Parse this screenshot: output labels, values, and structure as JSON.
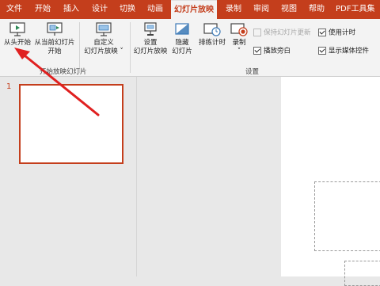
{
  "tabs": [
    "文件",
    "开始",
    "插入",
    "设计",
    "切换",
    "动画",
    "幻灯片放映",
    "录制",
    "审阅",
    "视图",
    "帮助",
    "PDF工具集"
  ],
  "active_tab": "幻灯片放映",
  "ribbon": {
    "from_beginning": "从头开始",
    "from_current_1": "从当前幻灯片",
    "from_current_2": "开始",
    "custom_1": "自定义",
    "custom_2": "幻灯片放映",
    "group1_label": "开始放映幻灯片",
    "setup_1": "设置",
    "setup_2": "幻灯片放映",
    "hide_1": "隐藏",
    "hide_2": "幻灯片",
    "rehearse": "排练计时",
    "record": "录制",
    "keep_updated": "保持幻灯片更新",
    "narration": "播放旁白",
    "use_timings": "使用计时",
    "show_media": "显示媒体控件",
    "group2_label": "设置"
  },
  "slides": {
    "number": "1"
  },
  "colors": {
    "accent": "#c43e1c",
    "arrow": "#e02020"
  }
}
